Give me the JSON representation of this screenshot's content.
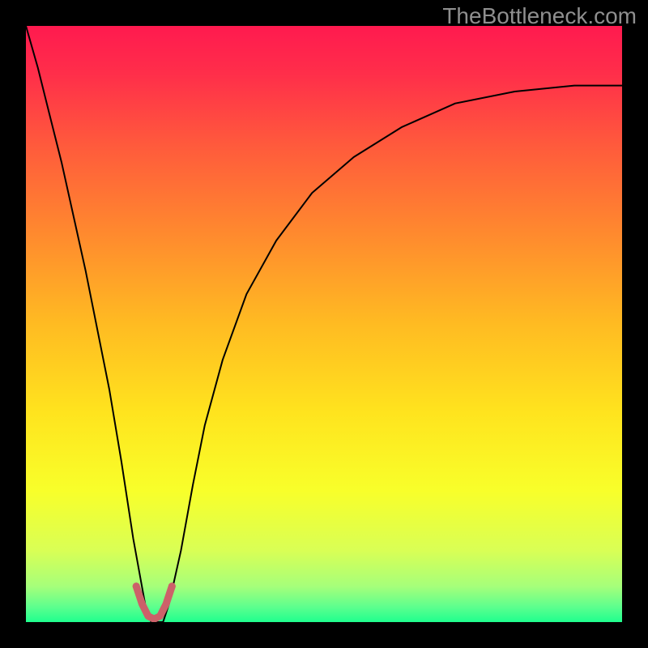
{
  "watermark": "TheBottleneck.com",
  "chart_data": {
    "type": "line",
    "title": "",
    "xlabel": "",
    "ylabel": "",
    "xlim": [
      0,
      100
    ],
    "ylim": [
      0,
      100
    ],
    "background": {
      "type": "vertical-gradient",
      "stops": [
        {
          "pos": 0.0,
          "color": "#ff1a4f"
        },
        {
          "pos": 0.08,
          "color": "#ff2e4a"
        },
        {
          "pos": 0.2,
          "color": "#ff5a3c"
        },
        {
          "pos": 0.35,
          "color": "#ff8a2e"
        },
        {
          "pos": 0.5,
          "color": "#ffbb22"
        },
        {
          "pos": 0.65,
          "color": "#ffe41e"
        },
        {
          "pos": 0.78,
          "color": "#f8ff2a"
        },
        {
          "pos": 0.88,
          "color": "#d9ff55"
        },
        {
          "pos": 0.94,
          "color": "#a6ff7a"
        },
        {
          "pos": 0.975,
          "color": "#5cff8e"
        },
        {
          "pos": 1.0,
          "color": "#1fff8e"
        }
      ]
    },
    "series": [
      {
        "name": "bottleneck-curve",
        "stroke": "#000000",
        "stroke_width": 2,
        "x": [
          0,
          2,
          4,
          6,
          8,
          10,
          12,
          14,
          16,
          18,
          20,
          21,
          22,
          23,
          24,
          26,
          28,
          30,
          33,
          37,
          42,
          48,
          55,
          63,
          72,
          82,
          92,
          100
        ],
        "y": [
          100,
          93,
          85,
          77,
          68,
          59,
          49,
          39,
          27,
          14,
          3,
          0,
          0,
          0,
          3,
          12,
          23,
          33,
          44,
          55,
          64,
          72,
          78,
          83,
          87,
          89,
          90,
          90
        ]
      }
    ],
    "markers": {
      "name": "optimal-range",
      "color": "#cc6169",
      "radius": 4.5,
      "stroke": "#cc6169",
      "stroke_width": 9,
      "x": [
        18.5,
        19.5,
        20.5,
        21.5,
        22.5,
        23.5,
        24.5
      ],
      "y": [
        6,
        3,
        1,
        0.5,
        1,
        3,
        6
      ]
    }
  }
}
